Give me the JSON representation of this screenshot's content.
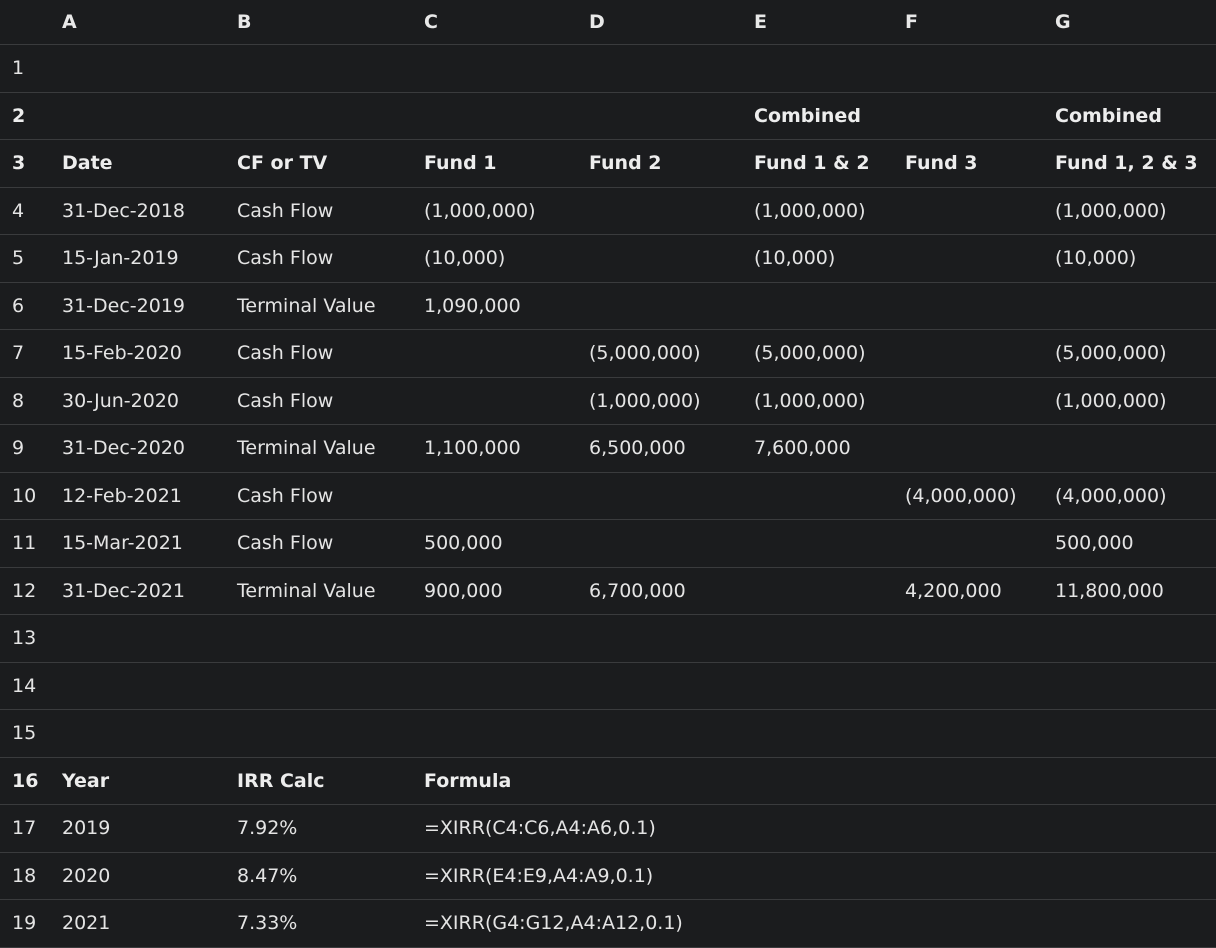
{
  "columns": [
    "A",
    "B",
    "C",
    "D",
    "E",
    "F",
    "G"
  ],
  "rows": [
    {
      "num": "1",
      "bold": false,
      "cells": [
        "",
        "",
        "",
        "",
        "",
        "",
        ""
      ]
    },
    {
      "num": "2",
      "bold": true,
      "cells": [
        "",
        "",
        "",
        "",
        "Combined",
        "",
        "Combined"
      ]
    },
    {
      "num": "3",
      "bold": true,
      "cells": [
        "Date",
        "CF or TV",
        "Fund 1",
        "Fund 2",
        "Fund 1 & 2",
        "Fund 3",
        "Fund 1, 2 & 3"
      ]
    },
    {
      "num": "4",
      "bold": false,
      "cells": [
        "31-Dec-2018",
        "Cash Flow",
        "(1,000,000)",
        "",
        "(1,000,000)",
        "",
        "(1,000,000)"
      ]
    },
    {
      "num": "5",
      "bold": false,
      "cells": [
        "15-Jan-2019",
        "Cash Flow",
        "(10,000)",
        "",
        "(10,000)",
        "",
        "(10,000)"
      ]
    },
    {
      "num": "6",
      "bold": false,
      "cells": [
        "31-Dec-2019",
        "Terminal Value",
        "1,090,000",
        "",
        "",
        "",
        ""
      ]
    },
    {
      "num": "7",
      "bold": false,
      "cells": [
        "15-Feb-2020",
        "Cash Flow",
        "",
        "(5,000,000)",
        "(5,000,000)",
        "",
        "(5,000,000)"
      ]
    },
    {
      "num": "8",
      "bold": false,
      "cells": [
        "30-Jun-2020",
        "Cash Flow",
        "",
        "(1,000,000)",
        "(1,000,000)",
        "",
        "(1,000,000)"
      ]
    },
    {
      "num": "9",
      "bold": false,
      "cells": [
        "31-Dec-2020",
        "Terminal Value",
        "1,100,000",
        "6,500,000",
        "7,600,000",
        "",
        ""
      ]
    },
    {
      "num": "10",
      "bold": false,
      "cells": [
        "12-Feb-2021",
        "Cash Flow",
        "",
        "",
        "",
        "(4,000,000)",
        "(4,000,000)"
      ]
    },
    {
      "num": "11",
      "bold": false,
      "cells": [
        "15-Mar-2021",
        "Cash Flow",
        "500,000",
        "",
        "",
        "",
        "500,000"
      ]
    },
    {
      "num": "12",
      "bold": false,
      "cells": [
        "31-Dec-2021",
        "Terminal Value",
        "900,000",
        "6,700,000",
        "",
        "4,200,000",
        "11,800,000"
      ]
    },
    {
      "num": "13",
      "bold": false,
      "cells": [
        "",
        "",
        "",
        "",
        "",
        "",
        ""
      ]
    },
    {
      "num": "14",
      "bold": false,
      "cells": [
        "",
        "",
        "",
        "",
        "",
        "",
        ""
      ]
    },
    {
      "num": "15",
      "bold": false,
      "cells": [
        "",
        "",
        "",
        "",
        "",
        "",
        ""
      ]
    },
    {
      "num": "16",
      "bold": true,
      "cells": [
        "Year",
        "IRR Calc",
        "Formula",
        "",
        "",
        "",
        ""
      ]
    },
    {
      "num": "17",
      "bold": false,
      "cells": [
        "2019",
        "7.92%",
        "=XIRR(C4:C6,A4:A6,0.1)",
        "",
        "",
        "",
        ""
      ]
    },
    {
      "num": "18",
      "bold": false,
      "cells": [
        "2020",
        "8.47%",
        "=XIRR(E4:E9,A4:A9,0.1)",
        "",
        "",
        "",
        ""
      ]
    },
    {
      "num": "19",
      "bold": false,
      "cells": [
        "2021",
        "7.33%",
        "=XIRR(G4:G12,A4:A12,0.1)",
        "",
        "",
        "",
        ""
      ]
    }
  ]
}
